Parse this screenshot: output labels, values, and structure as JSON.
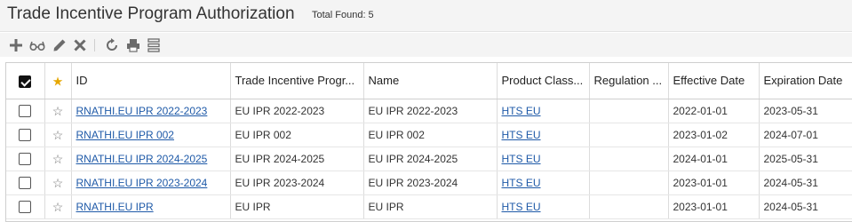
{
  "header": {
    "title": "Trade Incentive Program Authorization",
    "total_label": "Total Found:",
    "total_count": "5"
  },
  "toolbar": {
    "icons": [
      "add-icon",
      "view-icon",
      "edit-icon",
      "delete-icon",
      "refresh-icon",
      "print-icon",
      "columns-icon"
    ]
  },
  "grid": {
    "columns": [
      "ID",
      "Trade Incentive Progr...",
      "Name",
      "Product Class...",
      "Regulation ...",
      "Effective Date",
      "Expiration Date"
    ],
    "rows": [
      {
        "id": "RNATHI.EU IPR 2022-2023",
        "program": "EU IPR 2022-2023",
        "name": "EU IPR 2022-2023",
        "product_class": "HTS EU",
        "regulation": "",
        "effective": "2022-01-01",
        "expiration": "2023-05-31"
      },
      {
        "id": "RNATHI.EU IPR 002",
        "program": "EU IPR 002",
        "name": "EU IPR 002",
        "product_class": "HTS EU",
        "regulation": "",
        "effective": "2023-01-02",
        "expiration": "2024-07-01"
      },
      {
        "id": "RNATHI.EU IPR 2024-2025",
        "program": "EU IPR 2024-2025",
        "name": "EU IPR 2024-2025",
        "product_class": "HTS EU",
        "regulation": "",
        "effective": "2024-01-01",
        "expiration": "2025-05-31"
      },
      {
        "id": "RNATHI.EU IPR 2023-2024",
        "program": "EU IPR 2023-2024",
        "name": "EU IPR 2023-2024",
        "product_class": "HTS EU",
        "regulation": "",
        "effective": "2023-01-01",
        "expiration": "2024-05-31"
      },
      {
        "id": "RNATHI.EU IPR",
        "program": "EU IPR",
        "name": "EU IPR",
        "product_class": "HTS EU",
        "regulation": "",
        "effective": "2023-01-01",
        "expiration": "2024-05-31"
      }
    ]
  }
}
